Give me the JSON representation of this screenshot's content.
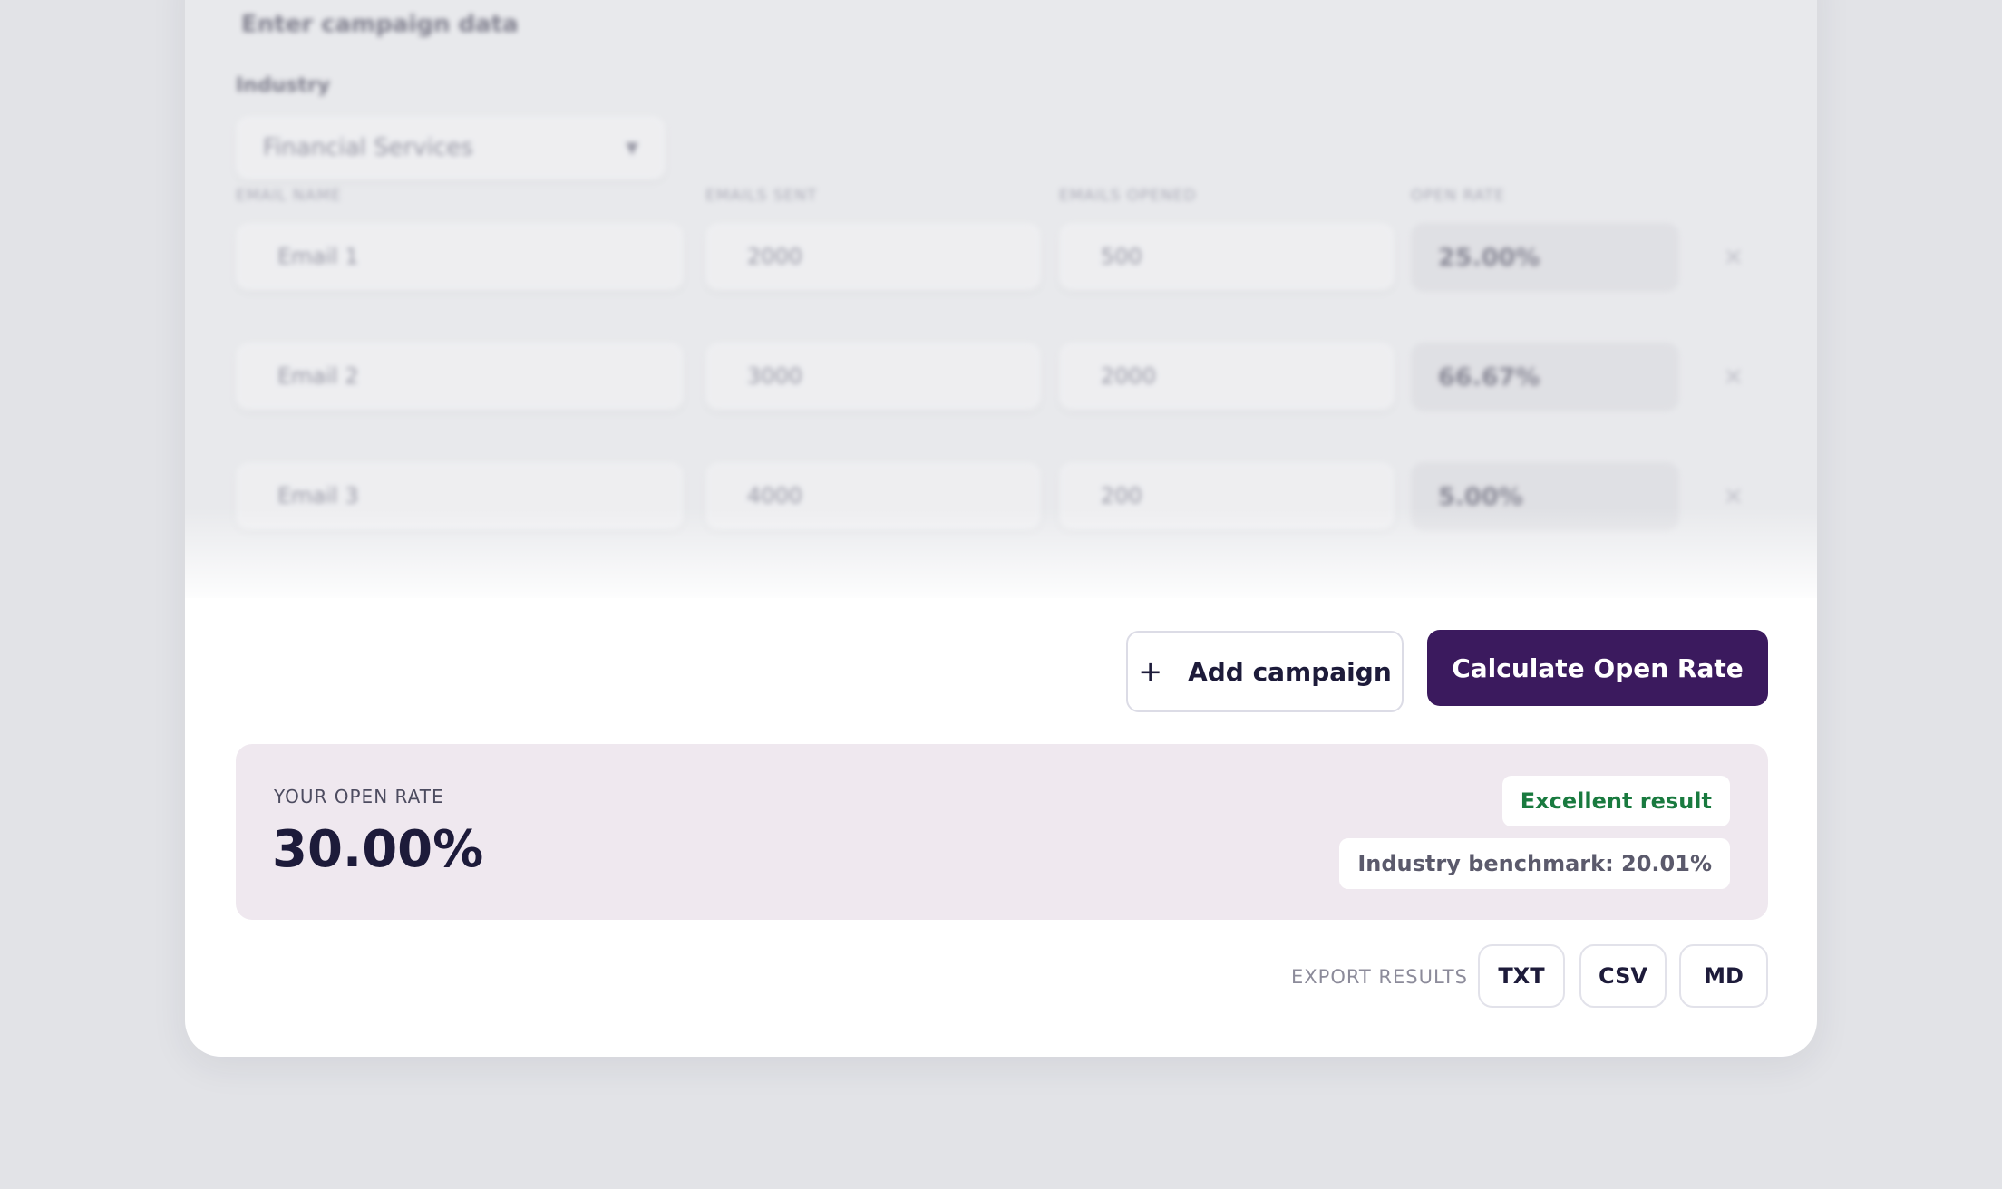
{
  "form": {
    "section_title": "Enter campaign data",
    "industry_label": "Industry",
    "industry_value": "Financial Services",
    "columns": [
      "EMAIL NAME",
      "EMAILS SENT",
      "EMAILS OPENED",
      "OPEN RATE"
    ],
    "rows": [
      {
        "name": "Email 1",
        "sent": "2000",
        "opened": "500",
        "rate": "25.00%"
      },
      {
        "name": "Email 2",
        "sent": "3000",
        "opened": "2000",
        "rate": "66.67%"
      },
      {
        "name": "Email 3",
        "sent": "4000",
        "opened": "200",
        "rate": "5.00%"
      }
    ],
    "remove_glyph": "×"
  },
  "actions": {
    "add_icon": "+",
    "add_label": "Add campaign",
    "calculate_label": "Calculate Open Rate"
  },
  "result": {
    "label": "YOUR OPEN RATE",
    "value": "30.00%",
    "status_badge": "Excellent result",
    "benchmark": "Industry benchmark: 20.01%"
  },
  "export": {
    "label": "EXPORT RESULTS",
    "formats": [
      "TXT",
      "CSV",
      "MD"
    ]
  },
  "colors": {
    "primary": "#3b1a5e",
    "success": "#197a3f",
    "result_bg": "#efe8ef",
    "page_bg": "#e2e3e7"
  }
}
